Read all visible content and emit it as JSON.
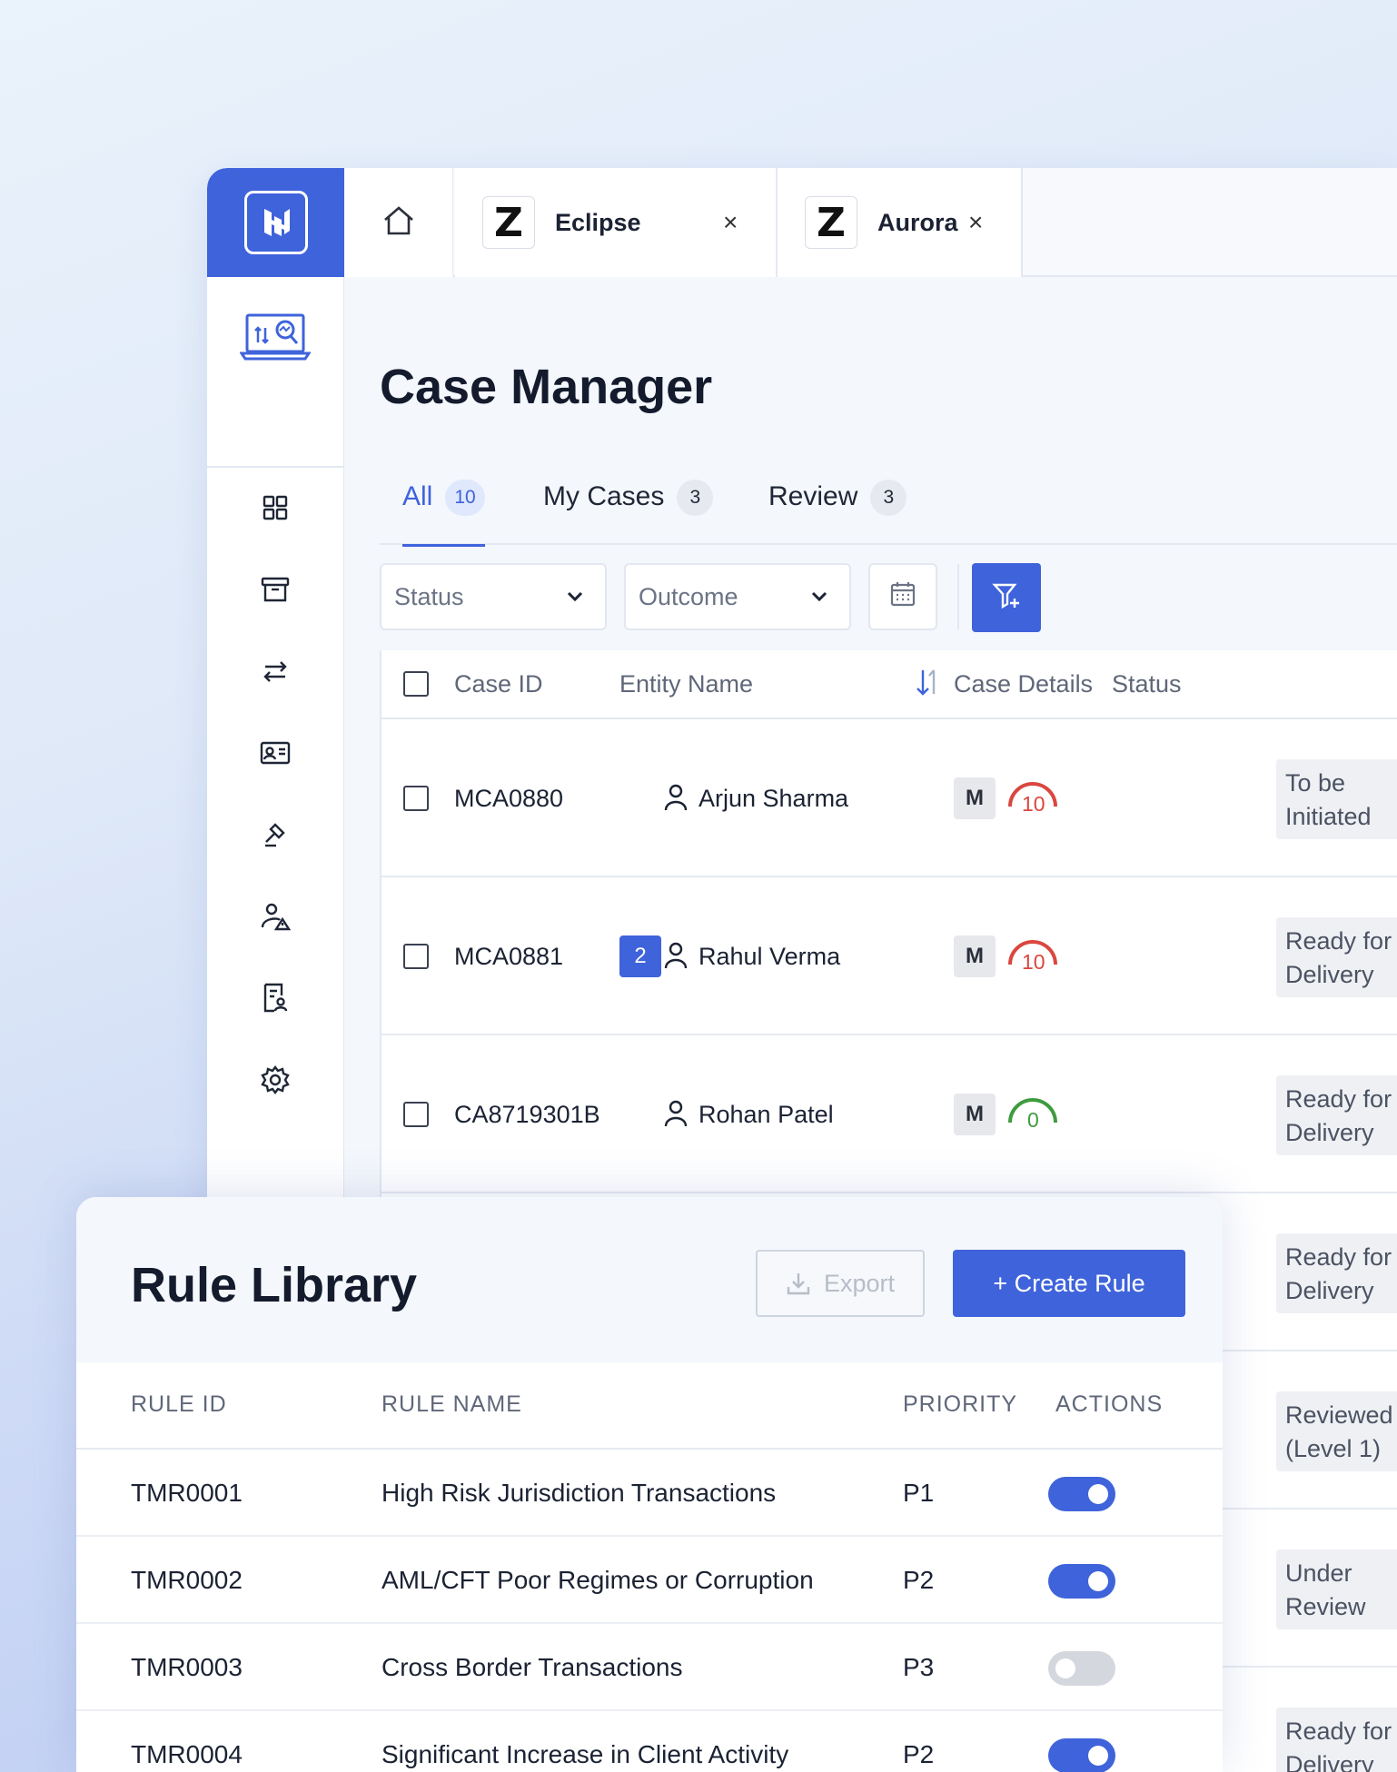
{
  "tabs": {
    "items": [
      {
        "logo": "Z",
        "name": "Eclipse"
      },
      {
        "logo": "Z",
        "name": "Aurora"
      }
    ],
    "close_symbol": "×"
  },
  "page": {
    "title": "Case Manager"
  },
  "subtabs": [
    {
      "label": "All",
      "count": "10"
    },
    {
      "label": "My Cases",
      "count": "3"
    },
    {
      "label": "Review",
      "count": "3"
    }
  ],
  "filters": {
    "status": "Status",
    "outcome": "Outcome"
  },
  "table": {
    "headers": {
      "case_id": "Case ID",
      "entity_name": "Entity Name",
      "case_details": "Case Details",
      "status": "Status"
    },
    "rows": [
      {
        "case_id": "MCA0880",
        "entity": "Arjun Sharma",
        "badge": "",
        "details": "M",
        "score": "10",
        "status": "To be\nInitiated"
      },
      {
        "case_id": "MCA0881",
        "entity": "Rahul Verma",
        "badge": "2",
        "details": "M",
        "score": "10",
        "status": "Ready for\nDelivery"
      },
      {
        "case_id": "CA8719301B",
        "entity": "Rohan Patel",
        "badge": "",
        "details": "M",
        "score": "0",
        "status": "Ready for\nDelivery"
      },
      {
        "status": "Ready for\nDelivery"
      },
      {
        "status": "Reviewed\n(Level 1)"
      },
      {
        "status": "Under\nReview"
      },
      {
        "status": "Ready for\nDelivery"
      }
    ]
  },
  "rule_library": {
    "title": "Rule Library",
    "export_label": "Export",
    "create_label": "+ Create Rule",
    "headers": {
      "rule_id": "RULE ID",
      "rule_name": "RULE NAME",
      "priority": "PRIORITY",
      "actions": "ACTIONS"
    },
    "rows": [
      {
        "id": "TMR0001",
        "name": "High Risk Jurisdiction Transactions",
        "priority": "P1",
        "enabled": true
      },
      {
        "id": "TMR0002",
        "name": "AML/CFT Poor Regimes or Corruption",
        "priority": "P2",
        "enabled": true
      },
      {
        "id": "TMR0003",
        "name": "Cross Border Transactions",
        "priority": "P3",
        "enabled": false
      },
      {
        "id": "TMR0004",
        "name": "Significant Increase in Client Activity",
        "priority": "P2",
        "enabled": true
      }
    ]
  },
  "colors": {
    "accent": "#3f63db",
    "risk_high": "#d9473f",
    "risk_low": "#3f9b3f"
  }
}
